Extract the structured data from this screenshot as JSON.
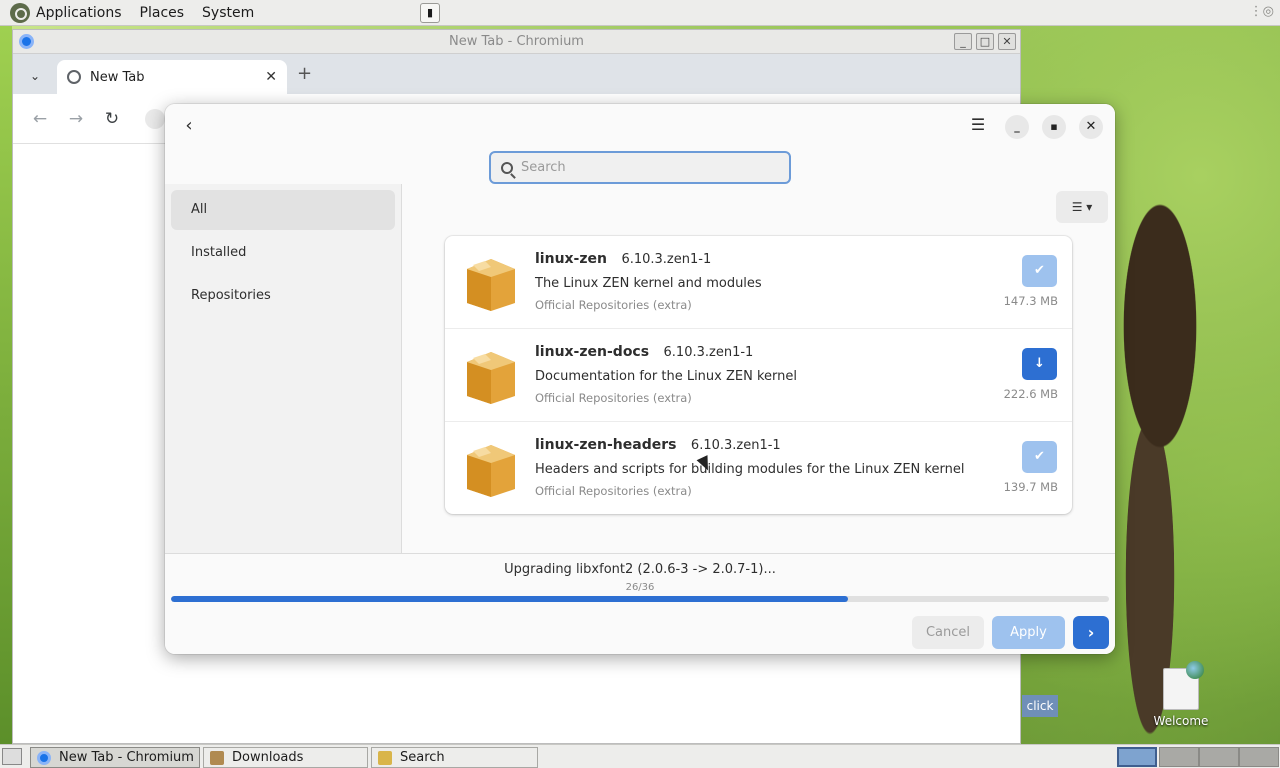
{
  "top_panel": {
    "menus": [
      "Applications",
      "Places",
      "System"
    ]
  },
  "chromium": {
    "title": "New Tab - Chromium",
    "tab_label": "New Tab",
    "new_tab_symbol": "+"
  },
  "dialog": {
    "search": {
      "placeholder": "Search",
      "value": ""
    },
    "sidebar": {
      "items": [
        {
          "label": "All",
          "selected": true
        },
        {
          "label": "Installed",
          "selected": false
        },
        {
          "label": "Repositories",
          "selected": false
        }
      ]
    },
    "packages": [
      {
        "name": "linux-zen",
        "version": "6.10.3.zen1-1",
        "description": "The Linux ZEN kernel and modules",
        "repository": "Official Repositories (extra)",
        "size": "147.3 MB",
        "state": "installed"
      },
      {
        "name": "linux-zen-docs",
        "version": "6.10.3.zen1-1",
        "description": "Documentation for the Linux ZEN kernel",
        "repository": "Official Repositories (extra)",
        "size": "222.6 MB",
        "state": "available"
      },
      {
        "name": "linux-zen-headers",
        "version": "6.10.3.zen1-1",
        "description": "Headers and scripts for building modules for the Linux ZEN kernel",
        "repository": "Official Repositories (extra)",
        "size": "139.7 MB",
        "state": "installed"
      }
    ],
    "footer": {
      "status": "Upgrading libxfont2 (2.0.6-3 -> 2.0.7-1)...",
      "counter": "26/36",
      "progress_fraction": 0.722,
      "cancel_label": "Cancel",
      "apply_label": "Apply"
    }
  },
  "desktop": {
    "welcome_label": "Welcome",
    "click_tag": "click"
  },
  "taskbar": {
    "tasks": [
      {
        "label": "New Tab - Chromium",
        "icon": "chromium-icon"
      },
      {
        "label": "Downloads",
        "icon": "folder-icon"
      },
      {
        "label": "Search",
        "icon": "search-app-icon"
      }
    ]
  },
  "colors": {
    "accent": "#2d6fd2",
    "accent_disabled": "#9ec2ee"
  }
}
